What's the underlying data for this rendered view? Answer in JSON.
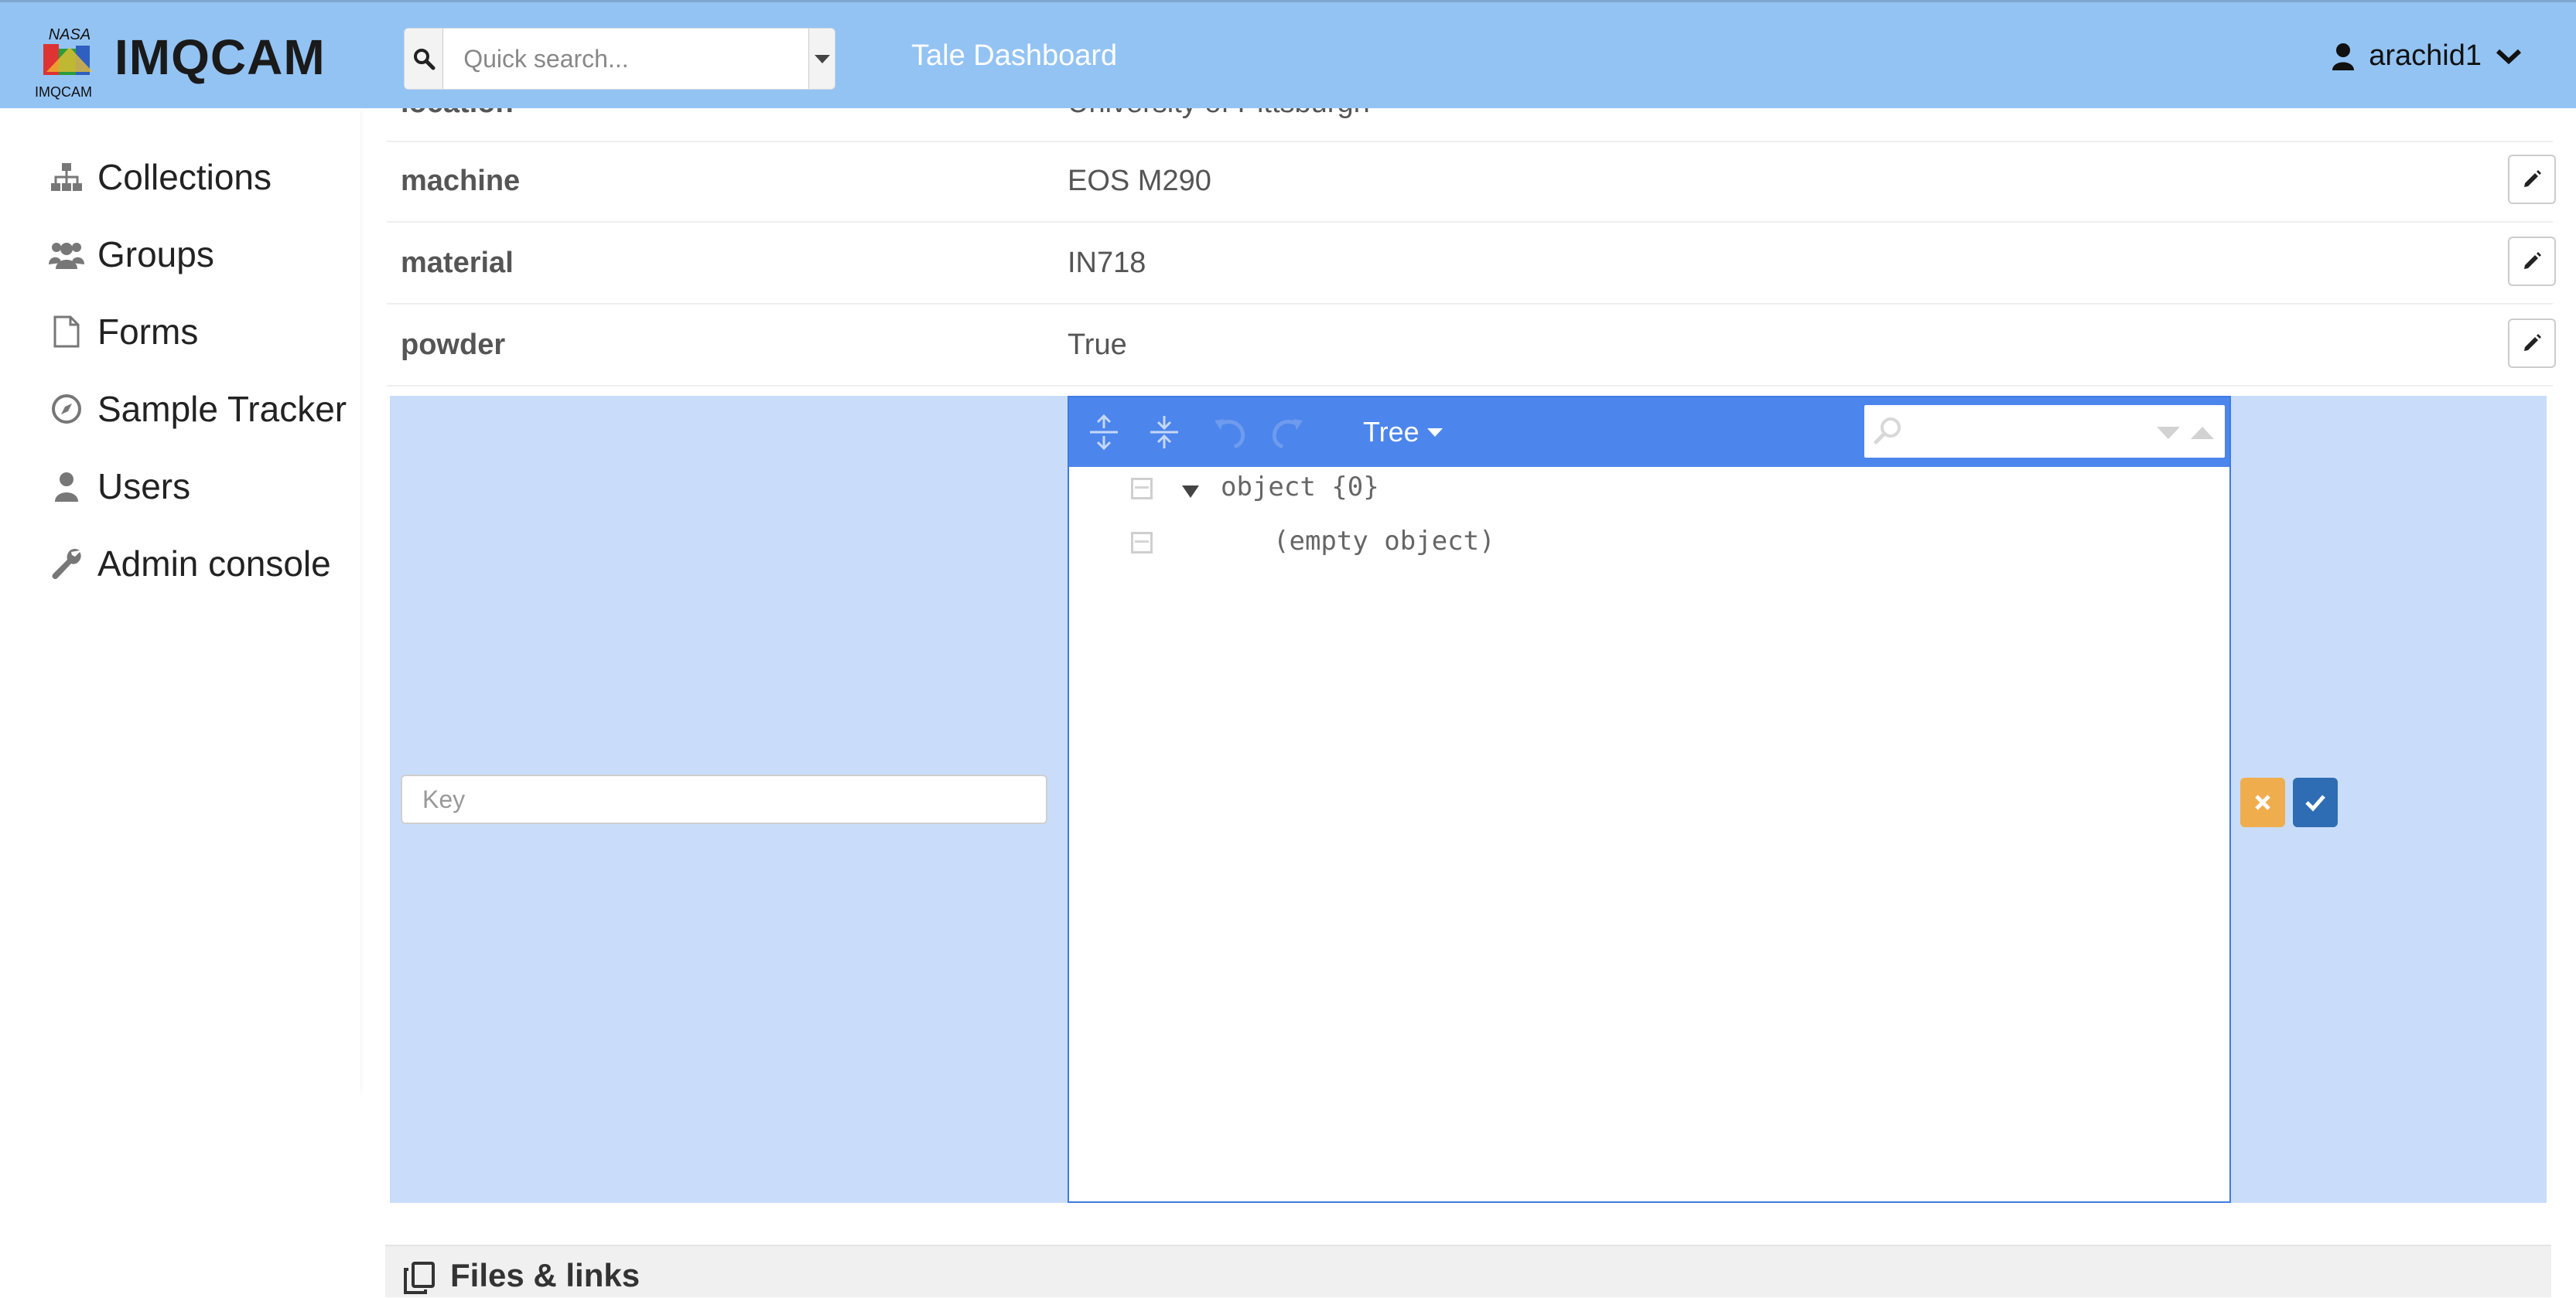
{
  "header": {
    "logo_text_top": "NASA",
    "logo_text_bottom": "IMQCAM",
    "brand": "IMQCAM",
    "search_placeholder": "Quick search...",
    "nav_title": "Tale Dashboard",
    "username": "arachid1",
    "bg_color": "#93c3f3"
  },
  "sidebar": {
    "items": [
      {
        "label": "Collections",
        "icon": "sitemap-icon"
      },
      {
        "label": "Groups",
        "icon": "users-icon"
      },
      {
        "label": "Forms",
        "icon": "file-icon"
      },
      {
        "label": "Sample Tracker",
        "icon": "compass-icon"
      },
      {
        "label": "Users",
        "icon": "user-icon"
      },
      {
        "label": "Admin console",
        "icon": "wrench-icon"
      }
    ]
  },
  "metadata": {
    "clipped_row": {
      "key": "location",
      "value": "University of Pittsburgh"
    },
    "rows": [
      {
        "key": "machine",
        "value": "EOS M290"
      },
      {
        "key": "material",
        "value": "IN718"
      },
      {
        "key": "powder",
        "value": "True"
      }
    ]
  },
  "editor": {
    "key_placeholder": "Key",
    "mode_label": "Tree",
    "tree": {
      "root_label": "object {0}",
      "empty_label": "(empty object)"
    },
    "panel_color": "#c9ddfa",
    "menu_color": "#4c85ec"
  },
  "files": {
    "title": "Files & links"
  }
}
